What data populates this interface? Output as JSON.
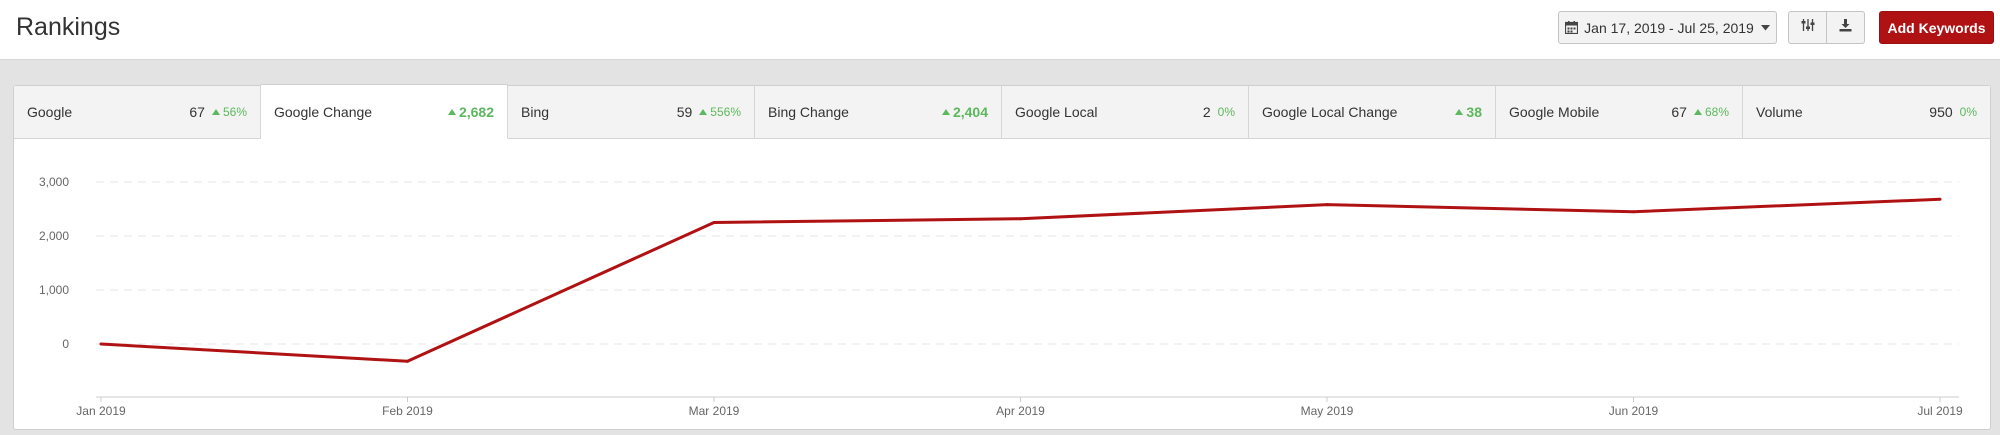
{
  "page": {
    "title": "Rankings"
  },
  "toolbar": {
    "date_range": "Jan 17, 2019 - Jul 25, 2019",
    "add_keywords_label": "Add Keywords"
  },
  "colors": {
    "accent": "#b01214",
    "positive": "#5cb85c",
    "line": "#b01214"
  },
  "icons": {
    "date": "calendar-icon",
    "caret": "caret-down-icon",
    "filters": "sliders-icon",
    "download": "download-icon",
    "up": "caret-up-icon"
  },
  "tabs": [
    {
      "name": "Google",
      "value": "67",
      "change": "56%",
      "active": false
    },
    {
      "name": "Google Change",
      "value": "",
      "change": "2,682",
      "active": true
    },
    {
      "name": "Bing",
      "value": "59",
      "change": "556%",
      "active": false
    },
    {
      "name": "Bing Change",
      "value": "",
      "change": "2,404",
      "active": false
    },
    {
      "name": "Google Local",
      "value": "2",
      "change": "0%",
      "active": false
    },
    {
      "name": "Google Local Change",
      "value": "",
      "change": "38",
      "active": false
    },
    {
      "name": "Google Mobile",
      "value": "67",
      "change": "68%",
      "active": false
    },
    {
      "name": "Volume",
      "value": "950",
      "change": "0%",
      "active": false
    }
  ],
  "chart_data": {
    "type": "line",
    "x": [
      "Jan 2019",
      "Feb 2019",
      "Mar 2019",
      "Apr 2019",
      "May 2019",
      "Jun 2019",
      "Jul 2019"
    ],
    "y_ticks": [
      "3,000",
      "2,000",
      "1,000",
      "0"
    ],
    "ylim": [
      -1000,
      3000
    ],
    "grid": true,
    "legend": "none",
    "series": [
      {
        "values": [
          0,
          -320,
          2250,
          2320,
          2580,
          2450,
          2680
        ]
      }
    ]
  }
}
